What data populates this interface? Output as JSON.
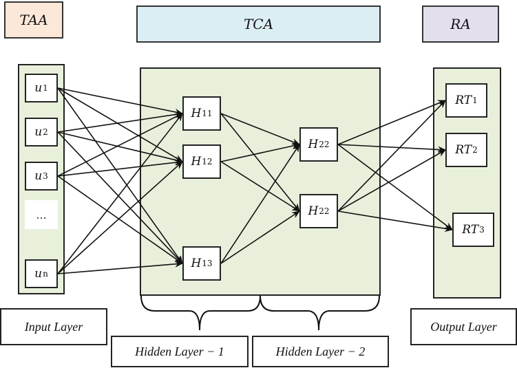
{
  "headers": {
    "taa": {
      "label": "TAA",
      "color": "#fce8d8"
    },
    "tca": {
      "label": "TCA",
      "color": "#dbeef3"
    },
    "ra": {
      "label": "RA",
      "color": "#e4dfec"
    }
  },
  "panel_color": "#e8f0dc",
  "input_nodes": [
    {
      "id": "u1",
      "base": "u",
      "sub": "1"
    },
    {
      "id": "u2",
      "base": "u",
      "sub": "2"
    },
    {
      "id": "u3",
      "base": "u",
      "sub": "3"
    },
    {
      "id": "un",
      "base": "u",
      "sub": "n"
    }
  ],
  "ellipsis": "...",
  "hidden1_nodes": [
    {
      "id": "h11",
      "base": "H",
      "sub": "11"
    },
    {
      "id": "h12",
      "base": "H",
      "sub": "12"
    },
    {
      "id": "h13",
      "base": "H",
      "sub": "13"
    }
  ],
  "hidden2_nodes": [
    {
      "id": "h21",
      "base": "H",
      "sub": "22"
    },
    {
      "id": "h22",
      "base": "H",
      "sub": "22"
    }
  ],
  "output_nodes": [
    {
      "id": "rt1",
      "base": "RT",
      "sub": "1"
    },
    {
      "id": "rt2",
      "base": "RT",
      "sub": "2"
    },
    {
      "id": "rt3",
      "base": "RT",
      "sub": "3"
    }
  ],
  "layer_labels": {
    "input": "Input Layer",
    "hidden1": "Hidden Layer − 1",
    "hidden2": "Hidden Layer − 2",
    "output": "Output Layer"
  },
  "edges": [
    [
      "u1",
      "h11"
    ],
    [
      "u1",
      "h12"
    ],
    [
      "u1",
      "h13"
    ],
    [
      "u2",
      "h11"
    ],
    [
      "u2",
      "h12"
    ],
    [
      "u2",
      "h13"
    ],
    [
      "u3",
      "h11"
    ],
    [
      "u3",
      "h12"
    ],
    [
      "u3",
      "h13"
    ],
    [
      "un",
      "h11"
    ],
    [
      "un",
      "h12"
    ],
    [
      "un",
      "h13"
    ],
    [
      "h11",
      "h21"
    ],
    [
      "h11",
      "h22"
    ],
    [
      "h12",
      "h21"
    ],
    [
      "h12",
      "h22"
    ],
    [
      "h13",
      "h21"
    ],
    [
      "h13",
      "h22"
    ],
    [
      "h21",
      "rt1"
    ],
    [
      "h21",
      "rt2"
    ],
    [
      "h21",
      "rt3"
    ],
    [
      "h22",
      "rt1"
    ],
    [
      "h22",
      "rt2"
    ],
    [
      "h22",
      "rt3"
    ]
  ]
}
